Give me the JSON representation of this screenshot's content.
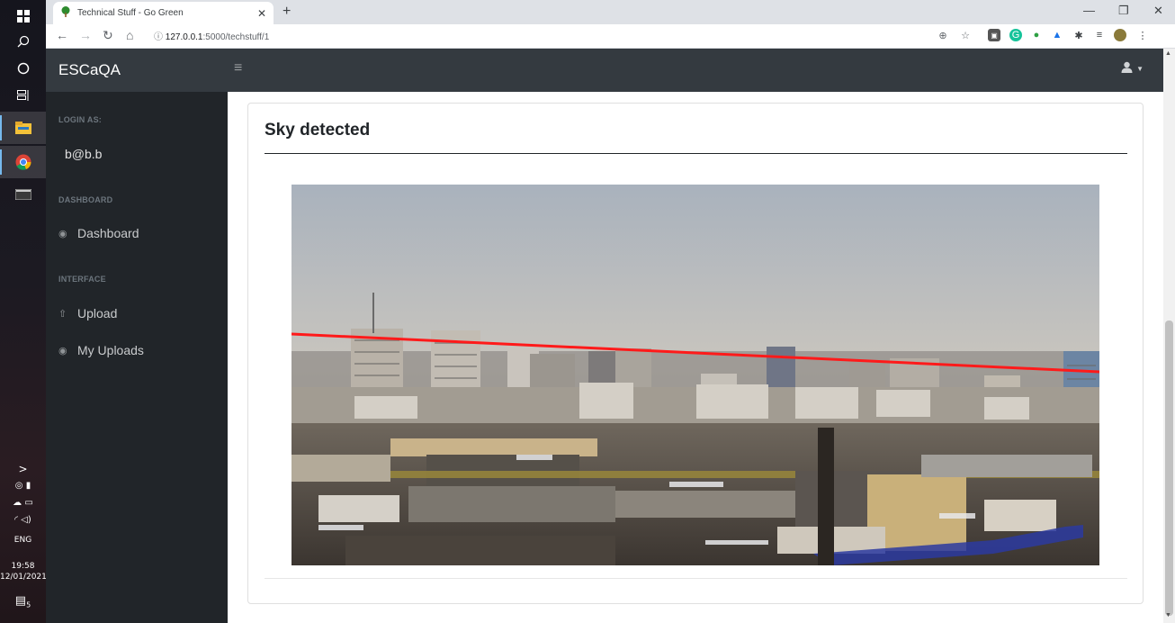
{
  "taskbar": {
    "icons": [
      "windows-start-icon",
      "search-icon",
      "cortana-icon",
      "task-view-icon",
      "file-explorer-icon",
      "chrome-icon",
      "terminal-icon"
    ],
    "tray": {
      "chevron": ">",
      "language": "ENG",
      "time": "19:58",
      "date": "12/01/2021",
      "notifications_count": "5"
    }
  },
  "browser": {
    "tab_title": "Technical Stuff - Go Green",
    "new_tab_label": "+",
    "url_host": "127.0.0.1",
    "url_rest": ":5000/techstuff/1"
  },
  "app": {
    "brand": "ESCaQA",
    "sidebar": {
      "login_heading": "LOGIN AS:",
      "user": "b@b.b",
      "dashboard_heading": "DASHBOARD",
      "dashboard_item": "Dashboard",
      "interface_heading": "INTERFACE",
      "upload_item": "Upload",
      "my_uploads_item": "My Uploads"
    },
    "card": {
      "title": "Sky detected"
    },
    "image": {
      "description_icon": "city-skyline-photo",
      "horizon_line_color": "#ff1a1a"
    }
  },
  "colors": {
    "appbar": "#343a40",
    "sidebar": "#212529",
    "accent_line": "#ff1a1a"
  }
}
